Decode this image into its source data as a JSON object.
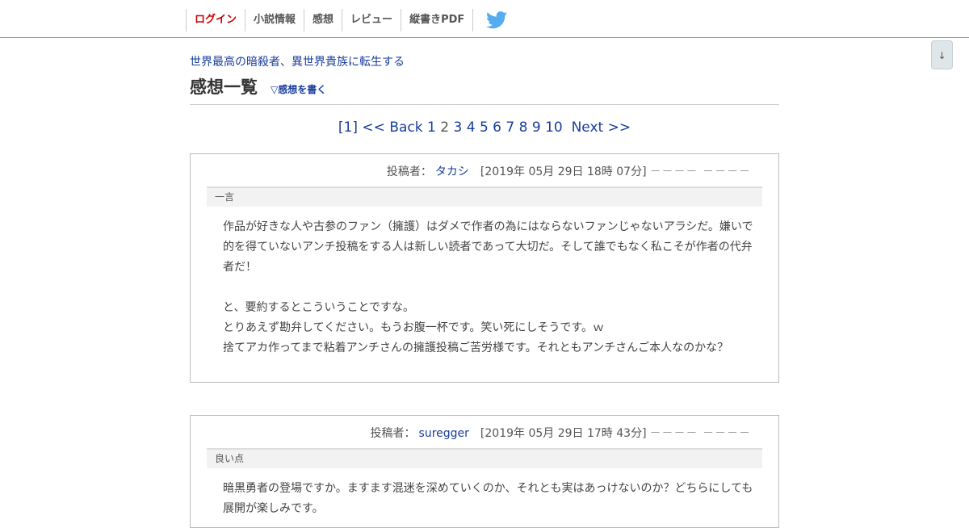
{
  "nav": {
    "items": [
      {
        "label": "ログイン"
      },
      {
        "label": "小説情報"
      },
      {
        "label": "感想"
      },
      {
        "label": "レビュー"
      },
      {
        "label": "縦書きPDF"
      }
    ],
    "twitter_icon": "twitter-icon",
    "twitter_color": "#55acee"
  },
  "pagedown": {
    "label": "↓"
  },
  "novel_title": "世界最高の暗殺者、異世界貴族に転生する",
  "page_title": "感想一覧",
  "write_link": "▽感想を書く",
  "pager": {
    "current": "[1]",
    "back": "<< Back",
    "pages": [
      "1",
      "2",
      "3",
      "4",
      "5",
      "6",
      "7",
      "8",
      "9",
      "10"
    ],
    "next": "Next >>"
  },
  "reviews": [
    {
      "author_label": "投稿者：",
      "author": "タカシ",
      "date": "[2019年 05月 29日 18時 07分]",
      "dashes": "－－－－ －－－－",
      "section": "一言",
      "paragraphs": [
        "作品が好きな人や古参のファン（擁護）はダメで作者の為にはならないファンじゃないアラシだ。嫌いで的を得ていないアンチ投稿をする人は新しい読者であって大切だ。そして誰でもなく私こそが作者の代弁者だ！",
        "",
        "と、要約するとこういうことですな。",
        "とりあえず勘弁してください。もうお腹一杯です。笑い死にしそうです。ｗ",
        "捨てアカ作ってまで粘着アンチさんの擁護投稿ご苦労様です。それともアンチさんご本人なのかな？"
      ]
    },
    {
      "author_label": "投稿者：",
      "author": "suregger",
      "date": "[2019年 05月 29日 17時 43分]",
      "dashes": "－－－－ －－－－",
      "section": "良い点",
      "paragraphs": [
        "暗黒勇者の登場ですか。ますます混迷を深めていくのか、それとも実はあっけないのか？どちらにしても展開が楽しみです。"
      ]
    }
  ]
}
